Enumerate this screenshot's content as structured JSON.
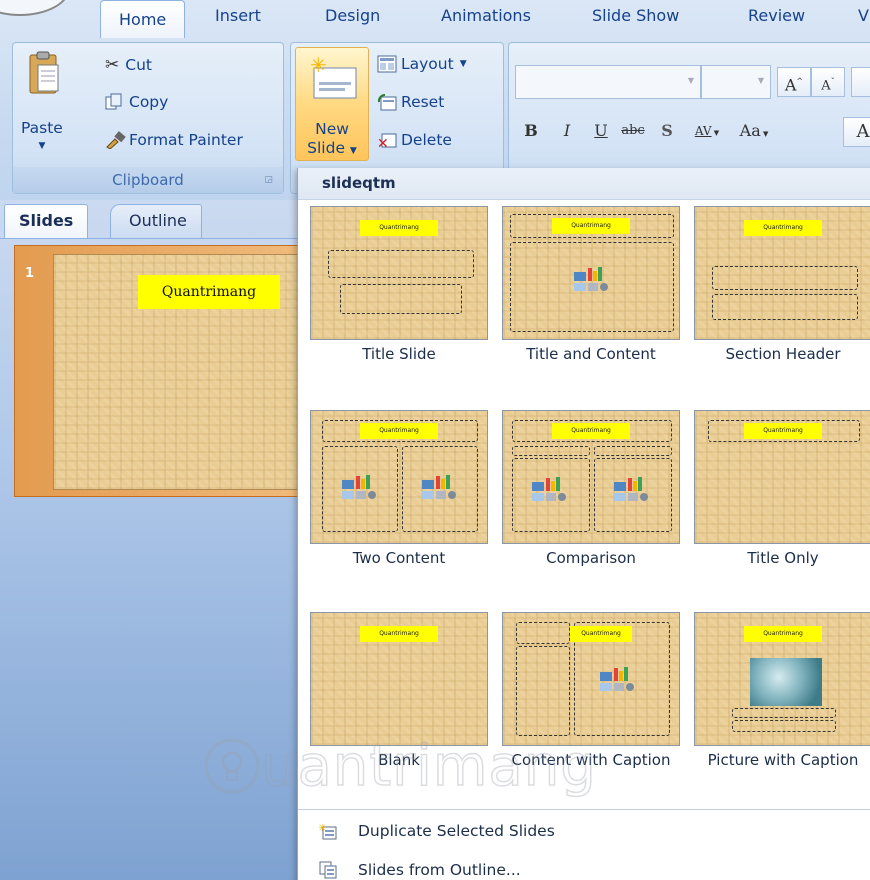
{
  "ribbon": {
    "tabs": [
      {
        "label": "Home",
        "active": true
      },
      {
        "label": "Insert"
      },
      {
        "label": "Design"
      },
      {
        "label": "Animations"
      },
      {
        "label": "Slide Show"
      },
      {
        "label": "Review"
      },
      {
        "label": "V"
      }
    ],
    "clipboard": {
      "paste_label": "Paste",
      "cut_label": "Cut",
      "copy_label": "Copy",
      "format_painter_label": "Format Painter",
      "group_label": "Clipboard"
    },
    "slides": {
      "new_slide_line1": "New",
      "new_slide_line2": "Slide",
      "layout_label": "Layout",
      "reset_label": "Reset",
      "delete_label": "Delete"
    },
    "font": {
      "grow": "A",
      "shrink": "A",
      "bold": "B",
      "italic": "I",
      "underline": "U",
      "strike": "abc",
      "shadow": "S",
      "spacing": "AV",
      "case": "Aa"
    }
  },
  "left_pane": {
    "tabs": [
      "Slides",
      "Outline"
    ],
    "slide_number": "1",
    "slide_title": "Quantrimang"
  },
  "gallery": {
    "theme_name": "slideqtm",
    "thumb_title": "Quantrimang",
    "layouts": [
      {
        "name": "Title Slide"
      },
      {
        "name": "Title and Content"
      },
      {
        "name": "Section Header"
      },
      {
        "name": "Two Content"
      },
      {
        "name": "Comparison"
      },
      {
        "name": "Title Only"
      },
      {
        "name": "Blank"
      },
      {
        "name": "Content with Caption"
      },
      {
        "name": "Picture with Caption"
      }
    ],
    "menu": [
      {
        "label": "Duplicate Selected Slides",
        "icon": "duplicate-slides-icon"
      },
      {
        "label": "Slides from Outline...",
        "icon": "outline-icon"
      }
    ]
  },
  "watermark": {
    "text": "uantrimang"
  },
  "colors": {
    "accent_yellow": "#ffff00",
    "ribbon_blue": "#c8daf1",
    "selected_slide": "#e39b4f"
  }
}
